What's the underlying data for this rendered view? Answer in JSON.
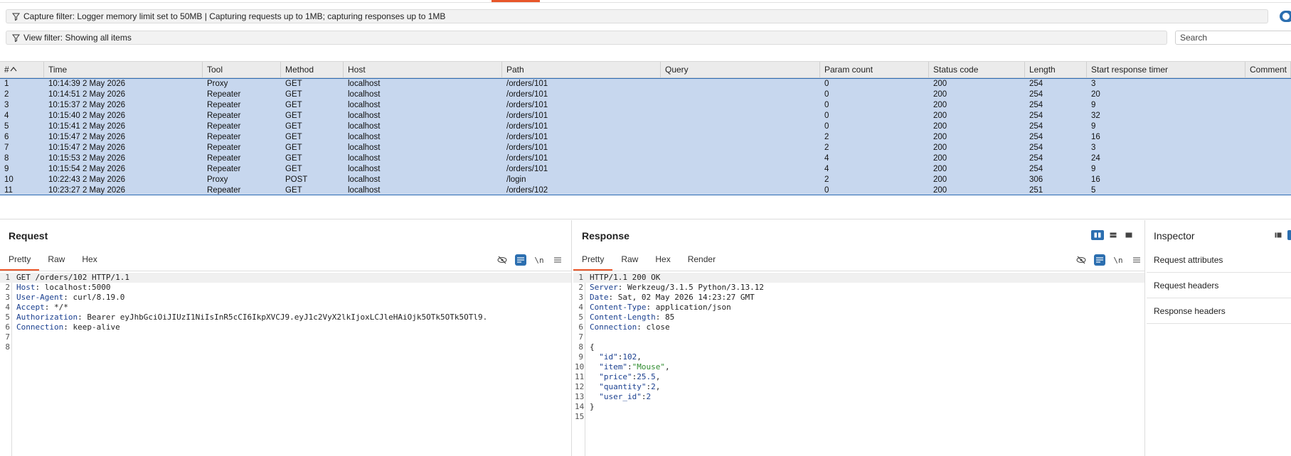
{
  "filters": {
    "capture": "Capture filter: Logger memory limit set to 50MB | Capturing requests up to 1MB; capturing responses up to 1MB",
    "view": "View filter: Showing all items",
    "search_placeholder": "Search"
  },
  "table": {
    "columns": [
      "#",
      "Time",
      "Tool",
      "Method",
      "Host",
      "Path",
      "Query",
      "Param count",
      "Status code",
      "Length",
      "Start response timer",
      "Comment"
    ],
    "rows": [
      [
        "1",
        "10:14:39 2 May 2026",
        "Proxy",
        "GET",
        "localhost",
        "/orders/101",
        "",
        "0",
        "200",
        "254",
        "3",
        ""
      ],
      [
        "2",
        "10:14:51 2 May 2026",
        "Repeater",
        "GET",
        "localhost",
        "/orders/101",
        "",
        "0",
        "200",
        "254",
        "20",
        ""
      ],
      [
        "3",
        "10:15:37 2 May 2026",
        "Repeater",
        "GET",
        "localhost",
        "/orders/101",
        "",
        "0",
        "200",
        "254",
        "9",
        ""
      ],
      [
        "4",
        "10:15:40 2 May 2026",
        "Repeater",
        "GET",
        "localhost",
        "/orders/101",
        "",
        "0",
        "200",
        "254",
        "32",
        ""
      ],
      [
        "5",
        "10:15:41 2 May 2026",
        "Repeater",
        "GET",
        "localhost",
        "/orders/101",
        "",
        "0",
        "200",
        "254",
        "9",
        ""
      ],
      [
        "6",
        "10:15:47 2 May 2026",
        "Repeater",
        "GET",
        "localhost",
        "/orders/101",
        "",
        "2",
        "200",
        "254",
        "16",
        ""
      ],
      [
        "7",
        "10:15:47 2 May 2026",
        "Repeater",
        "GET",
        "localhost",
        "/orders/101",
        "",
        "2",
        "200",
        "254",
        "3",
        ""
      ],
      [
        "8",
        "10:15:53 2 May 2026",
        "Repeater",
        "GET",
        "localhost",
        "/orders/101",
        "",
        "4",
        "200",
        "254",
        "24",
        ""
      ],
      [
        "9",
        "10:15:54 2 May 2026",
        "Repeater",
        "GET",
        "localhost",
        "/orders/101",
        "",
        "4",
        "200",
        "254",
        "9",
        ""
      ],
      [
        "10",
        "10:22:43 2 May 2026",
        "Proxy",
        "POST",
        "localhost",
        "/login",
        "",
        "2",
        "200",
        "306",
        "16",
        ""
      ],
      [
        "11",
        "10:23:27 2 May 2026",
        "Repeater",
        "GET",
        "localhost",
        "/orders/102",
        "",
        "0",
        "200",
        "251",
        "5",
        ""
      ]
    ]
  },
  "request": {
    "title": "Request",
    "tabs": [
      "Pretty",
      "Raw",
      "Hex"
    ],
    "newline_icon": "\\n",
    "lines": [
      {
        "n": "1",
        "k": "",
        "v": "GET /orders/102 HTTP/1.1"
      },
      {
        "n": "2",
        "k": "Host",
        "v": ": localhost:5000"
      },
      {
        "n": "3",
        "k": "User-Agent",
        "v": ": curl/8.19.0"
      },
      {
        "n": "4",
        "k": "Accept",
        "v": ": */*"
      },
      {
        "n": "5",
        "k": "Authorization",
        "v": ": Bearer eyJhbGciOiJIUzI1NiIsInR5cCI6IkpXVCJ9.eyJ1c2VyX2lkIjoxLCJleHAiOjk5OTk5OTk5OTl9."
      },
      {
        "n": "6",
        "k": "Connection",
        "v": ": keep-alive"
      },
      {
        "n": "7",
        "k": "",
        "v": ""
      },
      {
        "n": "8",
        "k": "",
        "v": ""
      }
    ]
  },
  "response": {
    "title": "Response",
    "tabs": [
      "Pretty",
      "Raw",
      "Hex",
      "Render"
    ],
    "newline_icon": "\\n",
    "lines": [
      {
        "n": "1",
        "k": "",
        "v": "HTTP/1.1 200 OK"
      },
      {
        "n": "2",
        "k": "Server",
        "v": ": Werkzeug/3.1.5 Python/3.13.12"
      },
      {
        "n": "3",
        "k": "Date",
        "v": ": Sat, 02 May 2026 14:23:27 GMT"
      },
      {
        "n": "4",
        "k": "Content-Type",
        "v": ": application/json"
      },
      {
        "n": "5",
        "k": "Content-Length",
        "v": ": 85"
      },
      {
        "n": "6",
        "k": "Connection",
        "v": ": close"
      },
      {
        "n": "7",
        "k": "",
        "v": ""
      },
      {
        "n": "8",
        "k": "",
        "v": "{"
      }
    ],
    "json_lines": [
      {
        "n": "9",
        "key": "\"id\"",
        "val": "102",
        "type": "num",
        "comma": ","
      },
      {
        "n": "10",
        "key": "\"item\"",
        "val": "\"Mouse\"",
        "type": "str",
        "comma": ","
      },
      {
        "n": "11",
        "key": "\"price\"",
        "val": "25.5",
        "type": "num",
        "comma": ","
      },
      {
        "n": "12",
        "key": "\"quantity\"",
        "val": "2",
        "type": "num",
        "comma": ","
      },
      {
        "n": "13",
        "key": "\"user_id\"",
        "val": "2",
        "type": "num",
        "comma": ""
      }
    ],
    "tail_lines": [
      {
        "n": "14",
        "v": "}"
      },
      {
        "n": "15",
        "v": ""
      }
    ]
  },
  "inspector": {
    "title": "Inspector",
    "items": [
      "Request attributes",
      "Request headers",
      "Response headers"
    ]
  },
  "colors": {
    "accent": "#e8562a",
    "selection": "#c7d7ee",
    "toggle_blue": "#2c6fb0"
  }
}
